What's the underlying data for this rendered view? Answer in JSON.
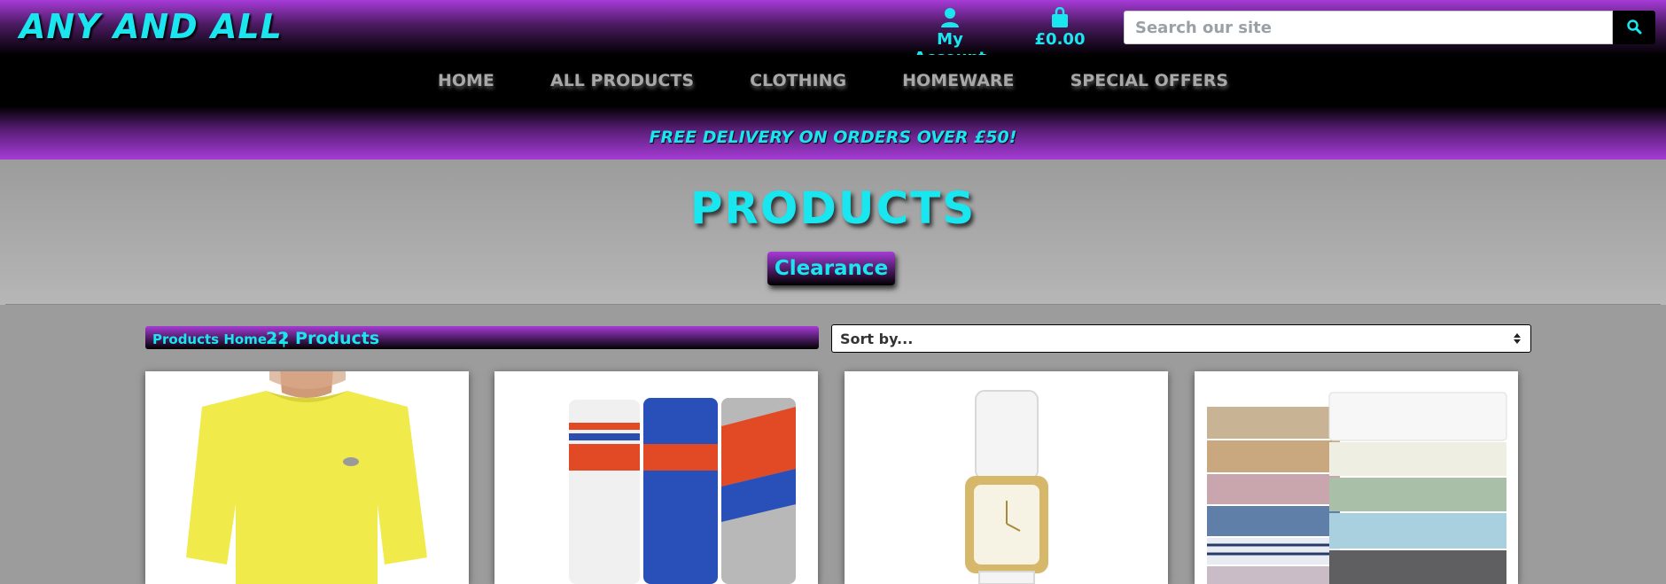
{
  "header": {
    "brand": "ANY AND ALL",
    "account_label": "My Account",
    "cart_total": "£0.00",
    "search_placeholder": "Search our site"
  },
  "nav": {
    "items": [
      {
        "label": "HOME"
      },
      {
        "label": "ALL PRODUCTS"
      },
      {
        "label": "CLOTHING"
      },
      {
        "label": "HOMEWARE"
      },
      {
        "label": "SPECIAL OFFERS"
      }
    ]
  },
  "promo": {
    "text": "FREE DELIVERY ON ORDERS OVER £50!"
  },
  "page": {
    "title": "PRODUCTS",
    "category_button": "Clearance"
  },
  "toolbar": {
    "breadcrumb": "Products Home - |",
    "product_count": "22 Products",
    "sort_value": "Sort by..."
  },
  "icons": {
    "account": "user-icon",
    "cart": "shopping-bag-icon",
    "search": "search-icon",
    "sort": "select-arrows-icon"
  },
  "colors": {
    "accent": "#19e6ee",
    "purple": "#a53bd6",
    "nav_text": "#a8a8a8",
    "background": "#9c9c9c"
  },
  "products": [
    {
      "image": "yellow-t-shirt"
    },
    {
      "image": "nike-socks"
    },
    {
      "image": "gold-watch"
    },
    {
      "image": "bed-sheets"
    }
  ]
}
